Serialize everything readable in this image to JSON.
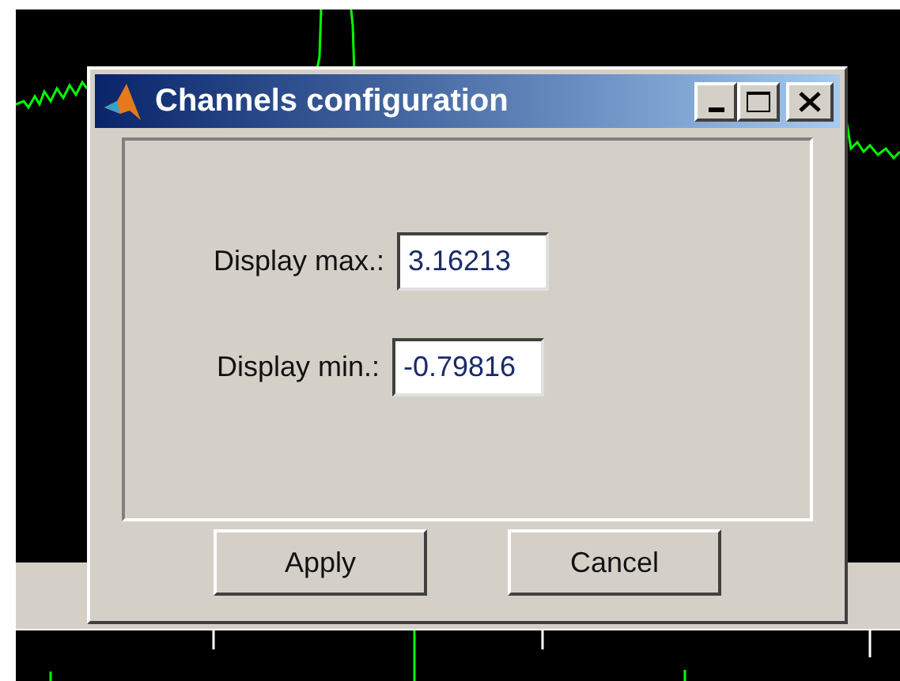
{
  "window": {
    "title": "Channels configuration"
  },
  "fields": [
    {
      "label": "Display max.:",
      "value": "3.16213"
    },
    {
      "label": "Display min.:",
      "value": "-0.79816"
    }
  ],
  "buttons": [
    "Apply",
    "Cancel"
  ]
}
